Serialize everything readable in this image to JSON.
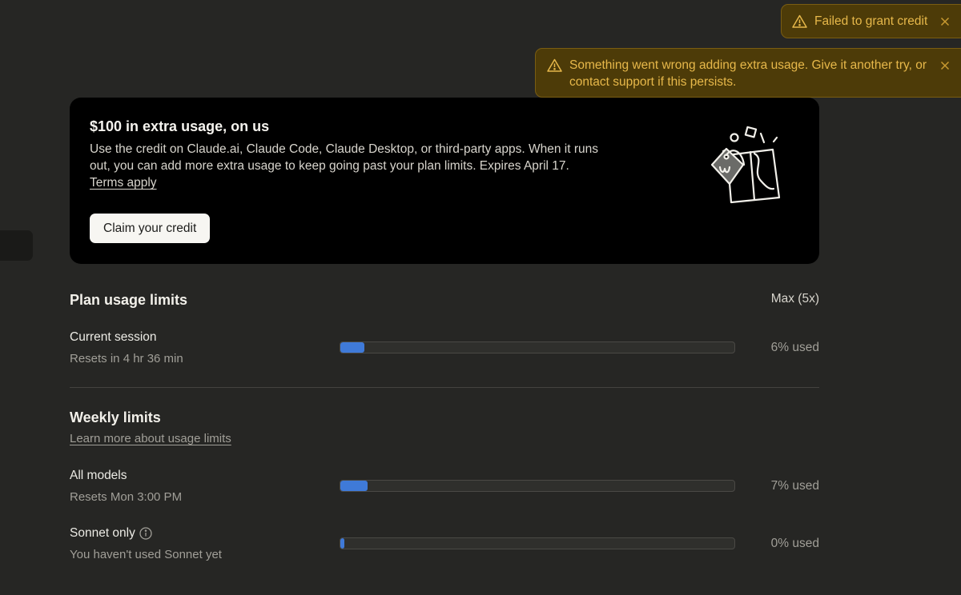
{
  "promo": {
    "title": "$100 in extra usage, on us",
    "body": "Use the credit on Claude.ai, Claude Code, Claude Desktop, or third-party apps. When it runs out, you can add more extra usage to keep going past your plan limits. Expires April 17.",
    "terms_link": "Terms apply",
    "claim_button": "Claim your credit"
  },
  "plan": {
    "section_title": "Plan usage limits",
    "plan_name": "Max (5x)",
    "current_session": {
      "title": "Current session",
      "subtitle": "Resets in 4 hr 36 min",
      "percent_used": 6,
      "used_label": "6% used"
    }
  },
  "weekly": {
    "section_title": "Weekly limits",
    "learn_more_link": "Learn more about usage limits",
    "all_models": {
      "title": "All models",
      "subtitle": "Resets Mon 3:00 PM",
      "percent_used": 7,
      "used_label": "7% used"
    },
    "sonnet_only": {
      "title": "Sonnet only",
      "subtitle": "You haven't used Sonnet yet",
      "percent_used": 0,
      "used_label": "0% used"
    }
  },
  "toasts": {
    "grant_failed": "Failed to grant credit",
    "extra_usage_error": "Something went wrong adding extra usage. Give it another try, or contact support if this persists."
  },
  "colors": {
    "background": "#262624",
    "progress_fill": "#3f7ad8",
    "toast_background": "#4d3b08",
    "toast_text": "#e7b84a"
  },
  "icons": {
    "warning": "warning-triangle-icon",
    "close": "close-icon",
    "info": "info-icon",
    "gift": "gift-tag-illustration"
  }
}
